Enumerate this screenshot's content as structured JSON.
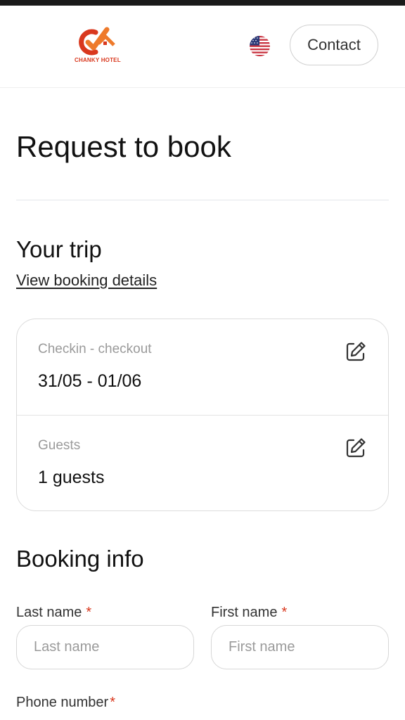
{
  "header": {
    "logo_text": "CHANKY HOTEL",
    "language_icon": "us-flag-icon",
    "contact_label": "Contact"
  },
  "page": {
    "title": "Request to book"
  },
  "trip": {
    "section_title": "Your trip",
    "view_details_link": "View booking details",
    "dates_label": "Checkin - checkout",
    "dates_value": "31/05 - 01/06",
    "guests_label": "Guests",
    "guests_value": "1 guests",
    "edit_icon": "edit-icon"
  },
  "booking_info": {
    "section_title": "Booking info",
    "last_name_label": "Last name",
    "last_name_placeholder": "Last name",
    "last_name_value": "",
    "first_name_label": "First name",
    "first_name_placeholder": "First name",
    "first_name_value": "",
    "phone_label": "Phone number",
    "required_mark": "*"
  },
  "colors": {
    "brand": "#d9381e",
    "text": "#111111",
    "muted": "#9a9a9a",
    "border": "#d7d7d7"
  }
}
